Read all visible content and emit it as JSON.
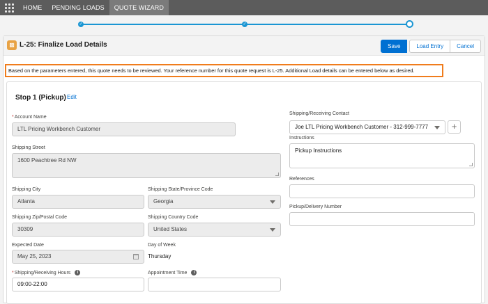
{
  "nav": {
    "tabs": [
      {
        "label": "HOME"
      },
      {
        "label": "PENDING LOADS"
      },
      {
        "label": "QUOTE WIZARD"
      }
    ]
  },
  "wizard": {
    "check_glyph": "✓"
  },
  "header": {
    "title": "L-25: Finalize Load Details",
    "icon": "truck-icon",
    "save_label": "Save",
    "load_entry_label": "Load Entry",
    "cancel_label": "Cancel"
  },
  "notice": "Based on the parameters entered, this quote needs to be reviewed. Your reference number for this quote request is L-25. Additional Load details can be entered below as desired.",
  "stop": {
    "title": "Stop 1 (Pickup)",
    "edit_label": "Edit"
  },
  "form": {
    "required_marker": "*",
    "account_name": {
      "label": "Account Name",
      "value": "LTL Pricing Workbench Customer"
    },
    "shipping_street": {
      "label": "Shipping Street",
      "value": "1600 Peachtree Rd NW"
    },
    "shipping_city": {
      "label": "Shipping City",
      "value": "Atlanta"
    },
    "shipping_state": {
      "label": "Shipping State/Province Code",
      "value": "Georgia"
    },
    "shipping_zip": {
      "label": "Shipping Zip/Postal Code",
      "value": "30309"
    },
    "shipping_country": {
      "label": "Shipping Country Code",
      "value": "United States"
    },
    "expected_date": {
      "label": "Expected Date",
      "value": "May 25, 2023"
    },
    "day_of_week": {
      "label": "Day of Week",
      "value": "Thursday"
    },
    "receiving_hours": {
      "label": "Shipping/Receiving Hours",
      "value": "09:00-22:00"
    },
    "appointment_time": {
      "label": "Appointment Time",
      "value": ""
    },
    "contact": {
      "label": "Shipping/Receiving Contact",
      "value": "Joe LTL Pricing Workbench Customer - 312-999-7777"
    },
    "instructions": {
      "label": "Instructions",
      "value": "Pickup Instructions"
    },
    "references": {
      "label": "References",
      "value": ""
    },
    "pickup_number": {
      "label": "Pickup/Delivery Number",
      "value": ""
    },
    "info_glyph": "i",
    "add_glyph": "+"
  },
  "colors": {
    "nav_bg": "#5c5c5c",
    "brand_blue": "#0070d2",
    "wizard_blue": "#1b96d3",
    "notice_border": "#f07c1c",
    "header_icon": "#e8a244"
  }
}
